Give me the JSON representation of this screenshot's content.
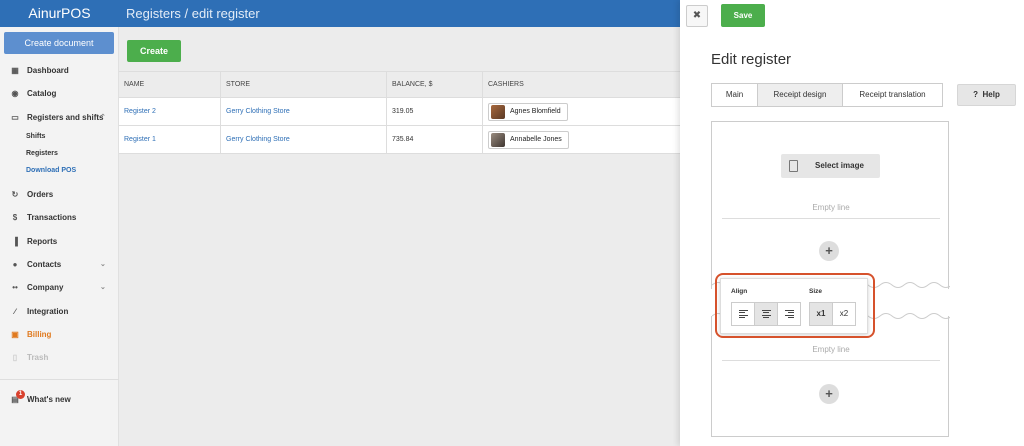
{
  "app": {
    "brand": "AinurPOS",
    "breadcrumb": "Registers / edit register"
  },
  "sidebar": {
    "create_document": "Create document",
    "items": [
      {
        "label": "Dashboard",
        "icon": "dashboard-icon",
        "glyph": "▦"
      },
      {
        "label": "Catalog",
        "icon": "catalog-icon",
        "glyph": "◉"
      },
      {
        "label": "Registers and shifts",
        "icon": "register-icon",
        "glyph": "▭",
        "chevron": "⌃"
      },
      {
        "label": "Orders",
        "icon": "orders-icon",
        "glyph": "↻"
      },
      {
        "label": "Transactions",
        "icon": "dollar-icon",
        "glyph": "$"
      },
      {
        "label": "Reports",
        "icon": "reports-icon",
        "glyph": "▐"
      },
      {
        "label": "Contacts",
        "icon": "contacts-icon",
        "glyph": "●",
        "chevron": "⌄"
      },
      {
        "label": "Company",
        "icon": "company-icon",
        "glyph": "••",
        "chevron": "⌄"
      },
      {
        "label": "Integration",
        "icon": "paperclip-icon",
        "glyph": "∕"
      },
      {
        "label": "Billing",
        "icon": "gift-icon",
        "glyph": "▣"
      },
      {
        "label": "Trash",
        "icon": "trash-icon",
        "glyph": "▯"
      }
    ],
    "sub_items": [
      "Shifts",
      "Registers",
      "Download POS"
    ],
    "whats_new": "What's new",
    "whats_new_badge": "1"
  },
  "main": {
    "create_button": "Create",
    "columns": [
      "NAME",
      "STORE",
      "BALANCE, $",
      "CASHIERS"
    ],
    "rows": [
      {
        "name": "Register 2",
        "store": "Gerry Clothing Store",
        "balance": "319.05",
        "cashier": "Agnes Blomfield"
      },
      {
        "name": "Register 1",
        "store": "Gerry Clothing Store",
        "balance": "735.84",
        "cashier": "Annabelle Jones"
      }
    ]
  },
  "panel": {
    "close_glyph": "✖",
    "save": "Save",
    "title": "Edit register",
    "tabs": [
      "Main",
      "Receipt design",
      "Receipt translation"
    ],
    "active_tab": "Receipt design",
    "help": "Help",
    "help_glyph": "?",
    "select_image": "Select image",
    "empty_line": "Empty line",
    "add_glyph": "+",
    "popover": {
      "align_label": "Align",
      "size_label": "Size",
      "sizes": [
        "x1",
        "x2"
      ],
      "selected_align": "center",
      "selected_size": "x1"
    }
  },
  "colors": {
    "brand_blue": "#2e6fb6",
    "green": "#4cae4c",
    "billing_orange": "#e07a1f",
    "highlight_red": "#d6522c"
  }
}
